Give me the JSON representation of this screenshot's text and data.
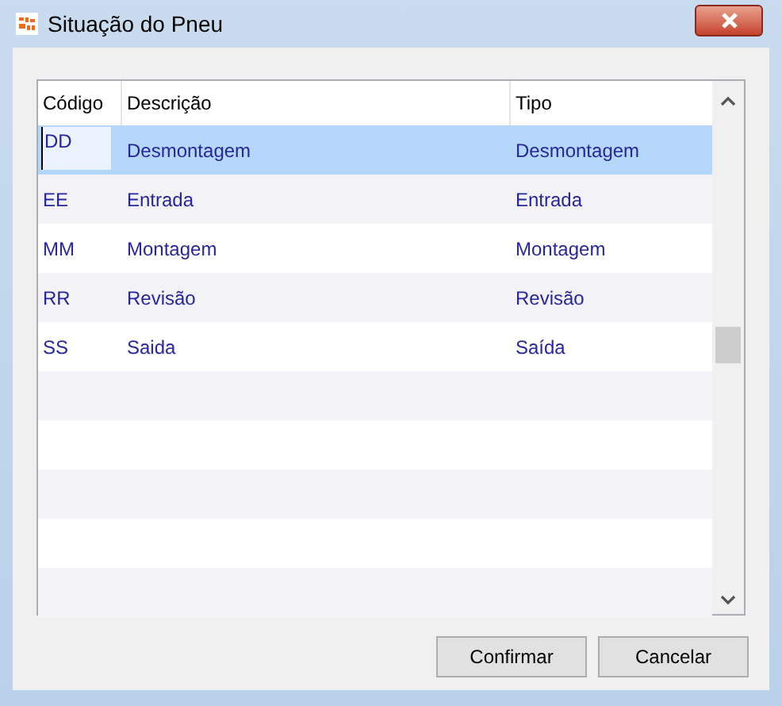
{
  "window": {
    "title": "Situação do Pneu"
  },
  "table": {
    "columns": [
      "Código",
      "Descrição",
      "Tipo"
    ],
    "rows": [
      {
        "codigo": "DD",
        "descricao": "Desmontagem",
        "tipo": "Desmontagem",
        "selected": true
      },
      {
        "codigo": "EE",
        "descricao": "Entrada",
        "tipo": "Entrada",
        "selected": false
      },
      {
        "codigo": "MM",
        "descricao": "Montagem",
        "tipo": "Montagem",
        "selected": false
      },
      {
        "codigo": "RR",
        "descricao": "Revisão",
        "tipo": "Revisão",
        "selected": false
      },
      {
        "codigo": "SS",
        "descricao": "Saida",
        "tipo": "Saída",
        "selected": false
      }
    ]
  },
  "buttons": [
    {
      "label": "Confirmar"
    },
    {
      "label": "Cancelar"
    }
  ]
}
